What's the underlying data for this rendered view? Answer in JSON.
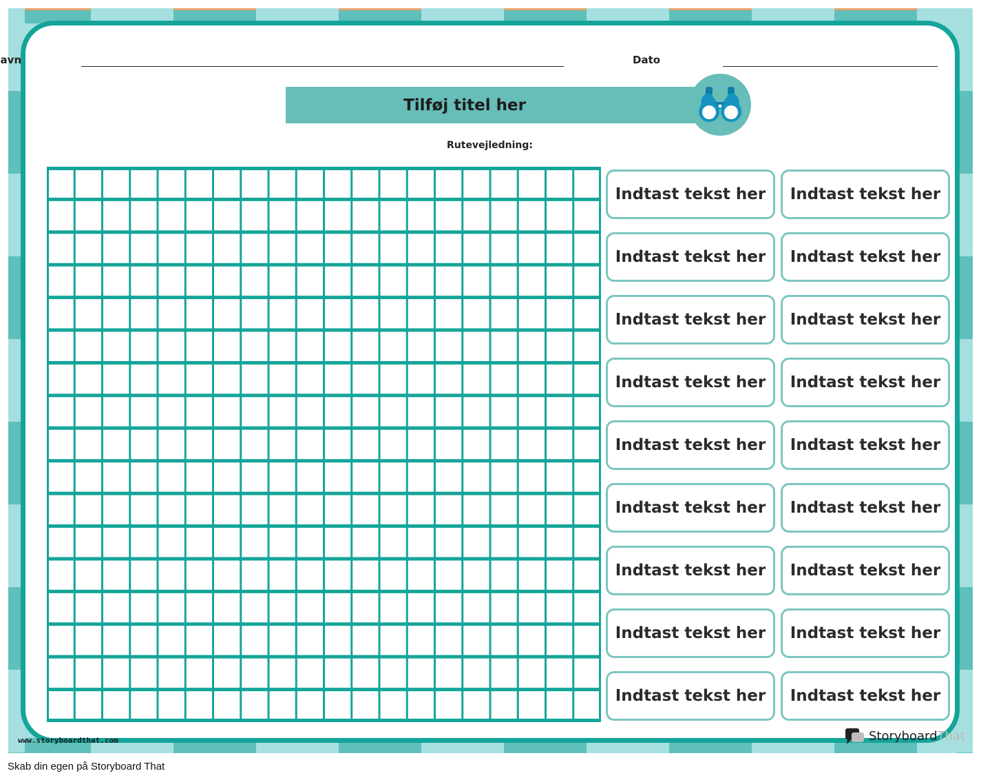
{
  "header": {
    "name_label": "Navn",
    "date_label": "Dato",
    "title": "Tilføj titel her",
    "directions_label": "Rutevejledning:"
  },
  "grid": {
    "columns": 20,
    "rows": 17
  },
  "word_boxes": [
    "Indtast tekst her",
    "Indtast tekst her",
    "Indtast tekst her",
    "Indtast tekst her",
    "Indtast tekst her",
    "Indtast tekst her",
    "Indtast tekst her",
    "Indtast tekst her",
    "Indtast tekst her",
    "Indtast tekst her",
    "Indtast tekst her",
    "Indtast tekst her",
    "Indtast tekst her",
    "Indtast tekst her",
    "Indtast tekst her",
    "Indtast tekst her",
    "Indtast tekst her",
    "Indtast tekst her"
  ],
  "footer": {
    "url": "www.storyboardthat.com",
    "brand_part1": "Storyboard",
    "brand_part2": "That",
    "note": "Skab din egen på Storyboard That"
  },
  "icons": {
    "header_icon": "binoculars-icon",
    "brand_icon": "speech-bubble-icon"
  },
  "colors": {
    "teal": "#14a59a",
    "banner": "#67bdb8",
    "light": "#a6dfdf"
  }
}
